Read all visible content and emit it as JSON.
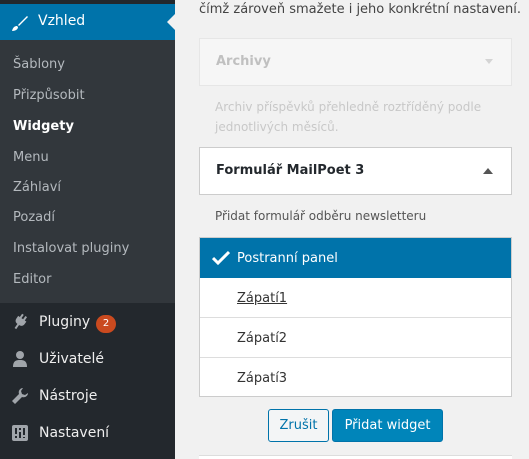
{
  "sidebar": {
    "active_menu": {
      "label": "Vzhled",
      "icon": "paintbrush-icon"
    },
    "submenu": [
      {
        "label": "Šablony",
        "current": false
      },
      {
        "label": "Přizpůsobit",
        "current": false
      },
      {
        "label": "Widgety",
        "current": true
      },
      {
        "label": "Menu",
        "current": false
      },
      {
        "label": "Záhlaví",
        "current": false
      },
      {
        "label": "Pozadí",
        "current": false
      },
      {
        "label": "Instalovat pluginy",
        "current": false
      },
      {
        "label": "Editor",
        "current": false
      }
    ],
    "menu": [
      {
        "label": "Pluginy",
        "icon": "plugin-icon",
        "badge": "2"
      },
      {
        "label": "Uživatelé",
        "icon": "users-icon"
      },
      {
        "label": "Nástroje",
        "icon": "wrench-icon"
      },
      {
        "label": "Nastavení",
        "icon": "settings-icon"
      }
    ]
  },
  "main": {
    "intro_text": "čímž zároveň smažete i jeho konkrétní nastavení.",
    "archive_widget": {
      "title": "Archivy",
      "description": "Archiv příspěvků přehledně roztříděný podle jednotlivých měsíců."
    },
    "mailpoet_widget": {
      "title": "Formulář MailPoet 3",
      "description": "Přidat formulář odběru newsletteru"
    },
    "sidebars": [
      {
        "label": "Postranní panel",
        "selected": true
      },
      {
        "label": "Zápatí1",
        "selected": false
      },
      {
        "label": "Zápatí2",
        "selected": false
      },
      {
        "label": "Zápatí3",
        "selected": false
      }
    ],
    "cancel_label": "Zrušit",
    "add_label": "Přidat widget"
  },
  "colors": {
    "accent": "#0073aa",
    "sidebar_bg": "#23282d",
    "submenu_bg": "#32373c",
    "badge": "#ca4a1f"
  }
}
